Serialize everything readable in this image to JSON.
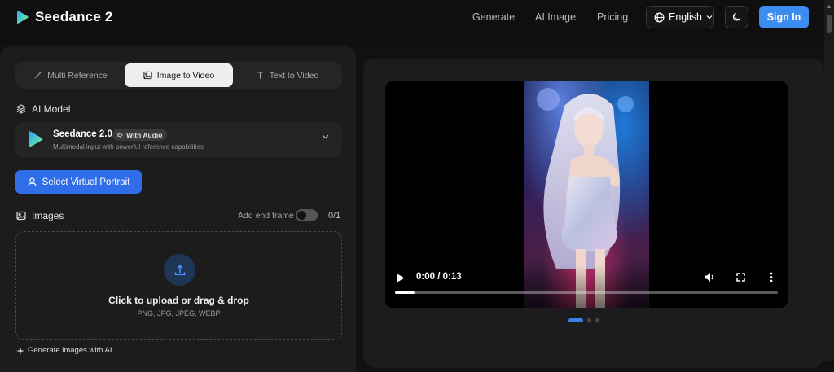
{
  "app": {
    "name": "Seedance 2",
    "brand_colors": {
      "logo_start": "#2aa7ff",
      "logo_end": "#7cf08a",
      "accent": "#3d8cf0"
    }
  },
  "header": {
    "nav": [
      "Generate",
      "AI Image",
      "Pricing"
    ],
    "language": "English",
    "sign_in": "Sign In"
  },
  "mode_tabs": [
    {
      "label": "Multi Reference",
      "icon": "magic-wand-icon",
      "active": false
    },
    {
      "label": "Image to Video",
      "icon": "image-icon",
      "active": true
    },
    {
      "label": "Text to Video",
      "icon": "text-icon",
      "active": false
    }
  ],
  "ai_model": {
    "section_label": "AI Model",
    "name": "Seedance 2.0",
    "badge": "With Audio",
    "description": "Multimodal input with powerful reference capabilities"
  },
  "portrait_button": "Select Virtual Portrait",
  "images": {
    "section_label": "Images",
    "end_frame_label": "Add end frame",
    "end_frame_enabled": false,
    "count": "0/1",
    "upload_title": "Click to upload or drag & drop",
    "upload_formats": "PNG, JPG, JPEG, WEBP"
  },
  "generate_ai_link": "Generate images with AI",
  "video": {
    "current_time": "0:00 / 0:13",
    "progress": 0.05
  },
  "carousel": {
    "count": 3,
    "active": 0
  }
}
